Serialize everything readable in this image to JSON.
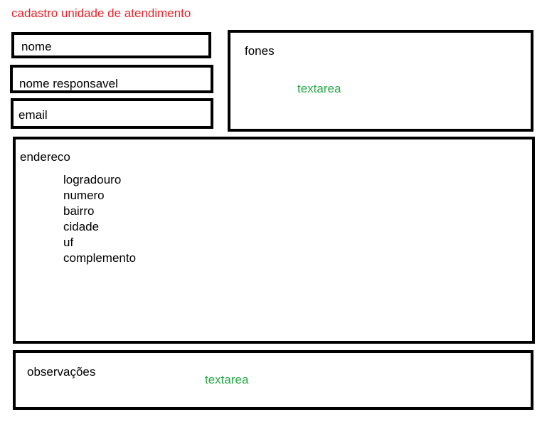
{
  "page": {
    "title": "cadastro unidade de atendimento"
  },
  "form": {
    "nome_label": "nome",
    "nome_responsavel_label": "nome responsavel",
    "email_label": "email",
    "fones": {
      "label": "fones",
      "control": "textarea"
    },
    "endereco": {
      "label": "endereco",
      "fields": [
        "logradouro",
        "numero",
        "bairro",
        "cidade",
        "uf",
        "complemento"
      ]
    },
    "observacoes": {
      "label": "observações",
      "control": "textarea"
    }
  },
  "colors": {
    "title": "#e8252b",
    "textarea_hint": "#2aa84a",
    "border": "#000000"
  }
}
